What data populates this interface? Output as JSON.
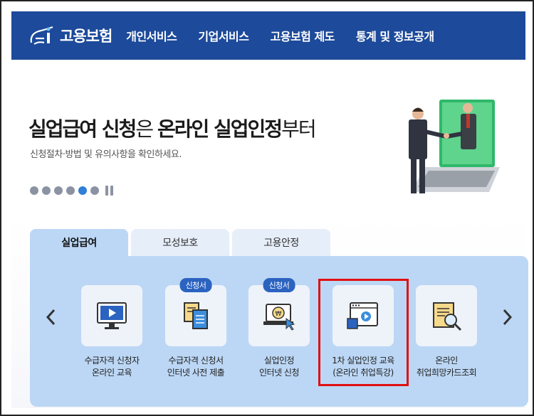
{
  "header": {
    "logo_text": "고용보험",
    "nav": [
      "개인서비스",
      "기업서비스",
      "고용보험 제도",
      "통계 및 정보공개"
    ]
  },
  "hero": {
    "title_part1": "실업급여 신청",
    "title_part2": "은 ",
    "title_part3": "온라인 실업인정",
    "title_part4": "부터",
    "subtitle": "신청절차·방법 및 유의사항을 확인하세요."
  },
  "tabs": [
    "실업급여",
    "모성보호",
    "고용안정"
  ],
  "services": [
    {
      "label1": "수급자격 신청자",
      "label2": "온라인 교육",
      "badge": "",
      "icon": "monitor-play-icon"
    },
    {
      "label1": "수급자격 신청서",
      "label2": "인터넷 사전 제출",
      "badge": "신청서",
      "icon": "documents-icon"
    },
    {
      "label1": "실업인정",
      "label2": "인터넷 신청",
      "badge": "신청서",
      "icon": "laptop-coin-icon"
    },
    {
      "label1": "1차 실업인정 교육",
      "label2": "(온라인 취업특강)",
      "badge": "",
      "icon": "browser-video-icon"
    },
    {
      "label1": "온라인",
      "label2": "취업희망카드조회",
      "badge": "",
      "icon": "card-search-icon"
    }
  ],
  "colors": {
    "header_bg": "#1d4a9a",
    "panel_bg": "#bcd7f5",
    "highlight": "#e01010",
    "badge": "#2b63c0"
  }
}
